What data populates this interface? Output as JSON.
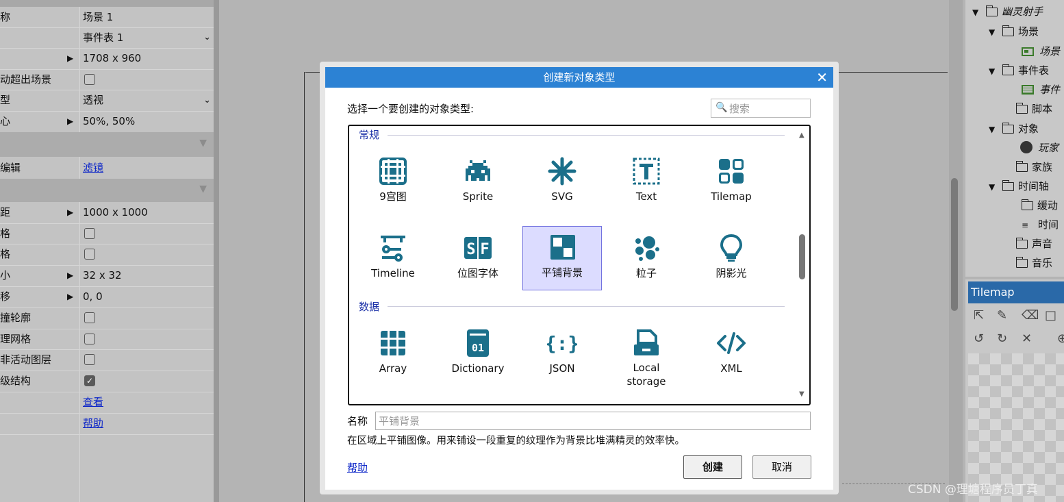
{
  "properties": {
    "rows": [
      {
        "label": "称",
        "value": "场景 1"
      },
      {
        "label": "",
        "value": "事件表 1"
      },
      {
        "label": "",
        "value": "1708 x 960"
      },
      {
        "label": "动超出场景",
        "value": ""
      },
      {
        "label": "型",
        "value": "透视"
      },
      {
        "label": "心",
        "value": "50%, 50%"
      },
      {
        "label": "编辑",
        "value": "滤镜"
      },
      {
        "label": "距",
        "value": "1000 x 1000"
      },
      {
        "label": "格",
        "value": ""
      },
      {
        "label": "格",
        "value": ""
      },
      {
        "label": "小",
        "value": "32 x 32"
      },
      {
        "label": "移",
        "value": "0, 0"
      },
      {
        "label": "撞轮廓",
        "value": ""
      },
      {
        "label": "理网格",
        "value": ""
      },
      {
        "label": "非活动图层",
        "value": ""
      },
      {
        "label": "级结构",
        "value": ""
      },
      {
        "label": "",
        "value": "查看"
      },
      {
        "label": "",
        "value": "帮助"
      }
    ]
  },
  "project": {
    "items": [
      {
        "label": "幽灵射手"
      },
      {
        "label": "场景"
      },
      {
        "label": "场景"
      },
      {
        "label": "事件表"
      },
      {
        "label": "事件"
      },
      {
        "label": "脚本"
      },
      {
        "label": "对象"
      },
      {
        "label": "玩家"
      },
      {
        "label": "家族"
      },
      {
        "label": "时间轴"
      },
      {
        "label": "缓动"
      },
      {
        "label": "时间"
      },
      {
        "label": "声音"
      },
      {
        "label": "音乐"
      }
    ],
    "tilemap_title": "Tilemap"
  },
  "watermark": "CSDN @理塘程序员丁真",
  "dialog": {
    "title": "创建新对象类型",
    "prompt": "选择一个要创建的对象类型:",
    "search_placeholder": "搜索",
    "categories": [
      {
        "name": "常规",
        "items": [
          {
            "label": "9宫图",
            "icon": "nine-patch-icon"
          },
          {
            "label": "Sprite",
            "icon": "sprite-icon"
          },
          {
            "label": "SVG",
            "icon": "svg-icon"
          },
          {
            "label": "Text",
            "icon": "text-icon"
          },
          {
            "label": "Tilemap",
            "icon": "tilemap-icon"
          },
          {
            "label": "Timeline",
            "icon": "timeline-icon"
          },
          {
            "label": "位图字体",
            "icon": "sprite-font-icon"
          },
          {
            "label": "平铺背景",
            "icon": "tiled-background-icon",
            "selected": true
          },
          {
            "label": "粒子",
            "icon": "particles-icon"
          },
          {
            "label": "阴影光",
            "icon": "shadow-light-icon"
          }
        ]
      },
      {
        "name": "数据",
        "items": [
          {
            "label": "Array",
            "icon": "array-icon"
          },
          {
            "label": "Dictionary",
            "icon": "dictionary-icon"
          },
          {
            "label": "JSON",
            "icon": "json-icon"
          },
          {
            "label": "Local storage",
            "icon": "local-storage-icon"
          },
          {
            "label": "XML",
            "icon": "xml-icon"
          }
        ]
      }
    ],
    "name_label": "名称",
    "name_placeholder": "平铺背景",
    "description": "在区域上平铺图像。用来铺设一段重复的纹理作为背景比堆满精灵的效率快。",
    "help_label": "帮助",
    "create_label": "创建",
    "cancel_label": "取消"
  },
  "colors": {
    "accent": "#2c82d4",
    "icon": "#1b6f8a",
    "category": "#1c31a8",
    "selection": "#dcdcff"
  }
}
